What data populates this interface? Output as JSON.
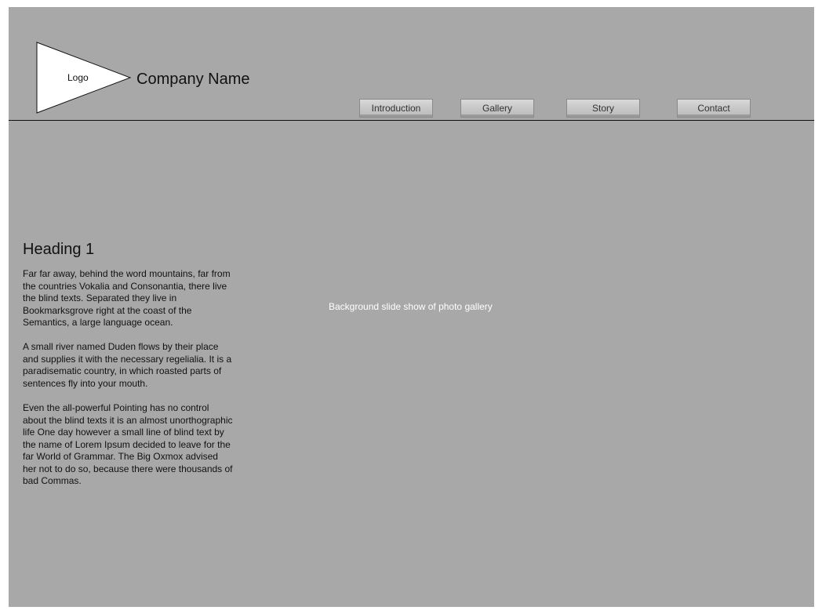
{
  "header": {
    "logo_label": "Logo",
    "company_name": "Company Name"
  },
  "nav": {
    "introduction": "Introduction",
    "gallery": "Gallery",
    "story": "Story",
    "contact": "Contact"
  },
  "content": {
    "heading": "Heading 1",
    "paragraphs": [
      "Far far away, behind the word mountains, far from the countries Vokalia and Consonantia, there live the blind texts. Separated they live in Bookmarksgrove right at the coast of the Semantics, a large language ocean.",
      "A small river named Duden flows by their place and supplies it with the necessary regelialia. It is a paradisematic country, in which roasted parts of sentences fly into your mouth.",
      "Even the all-powerful Pointing has no control about the blind texts it is an almost unorthographic life One day however a small line of blind text by the name of Lorem Ipsum decided to leave for the far World of Grammar. The Big Oxmox advised her not to do so, because there were thousands of bad Commas."
    ]
  },
  "gallery": {
    "placeholder_label": "Background slide show of photo gallery"
  },
  "colors": {
    "background": "#a8a8a8",
    "header_divider": "#111111",
    "gallery_label": "#ffffff"
  }
}
